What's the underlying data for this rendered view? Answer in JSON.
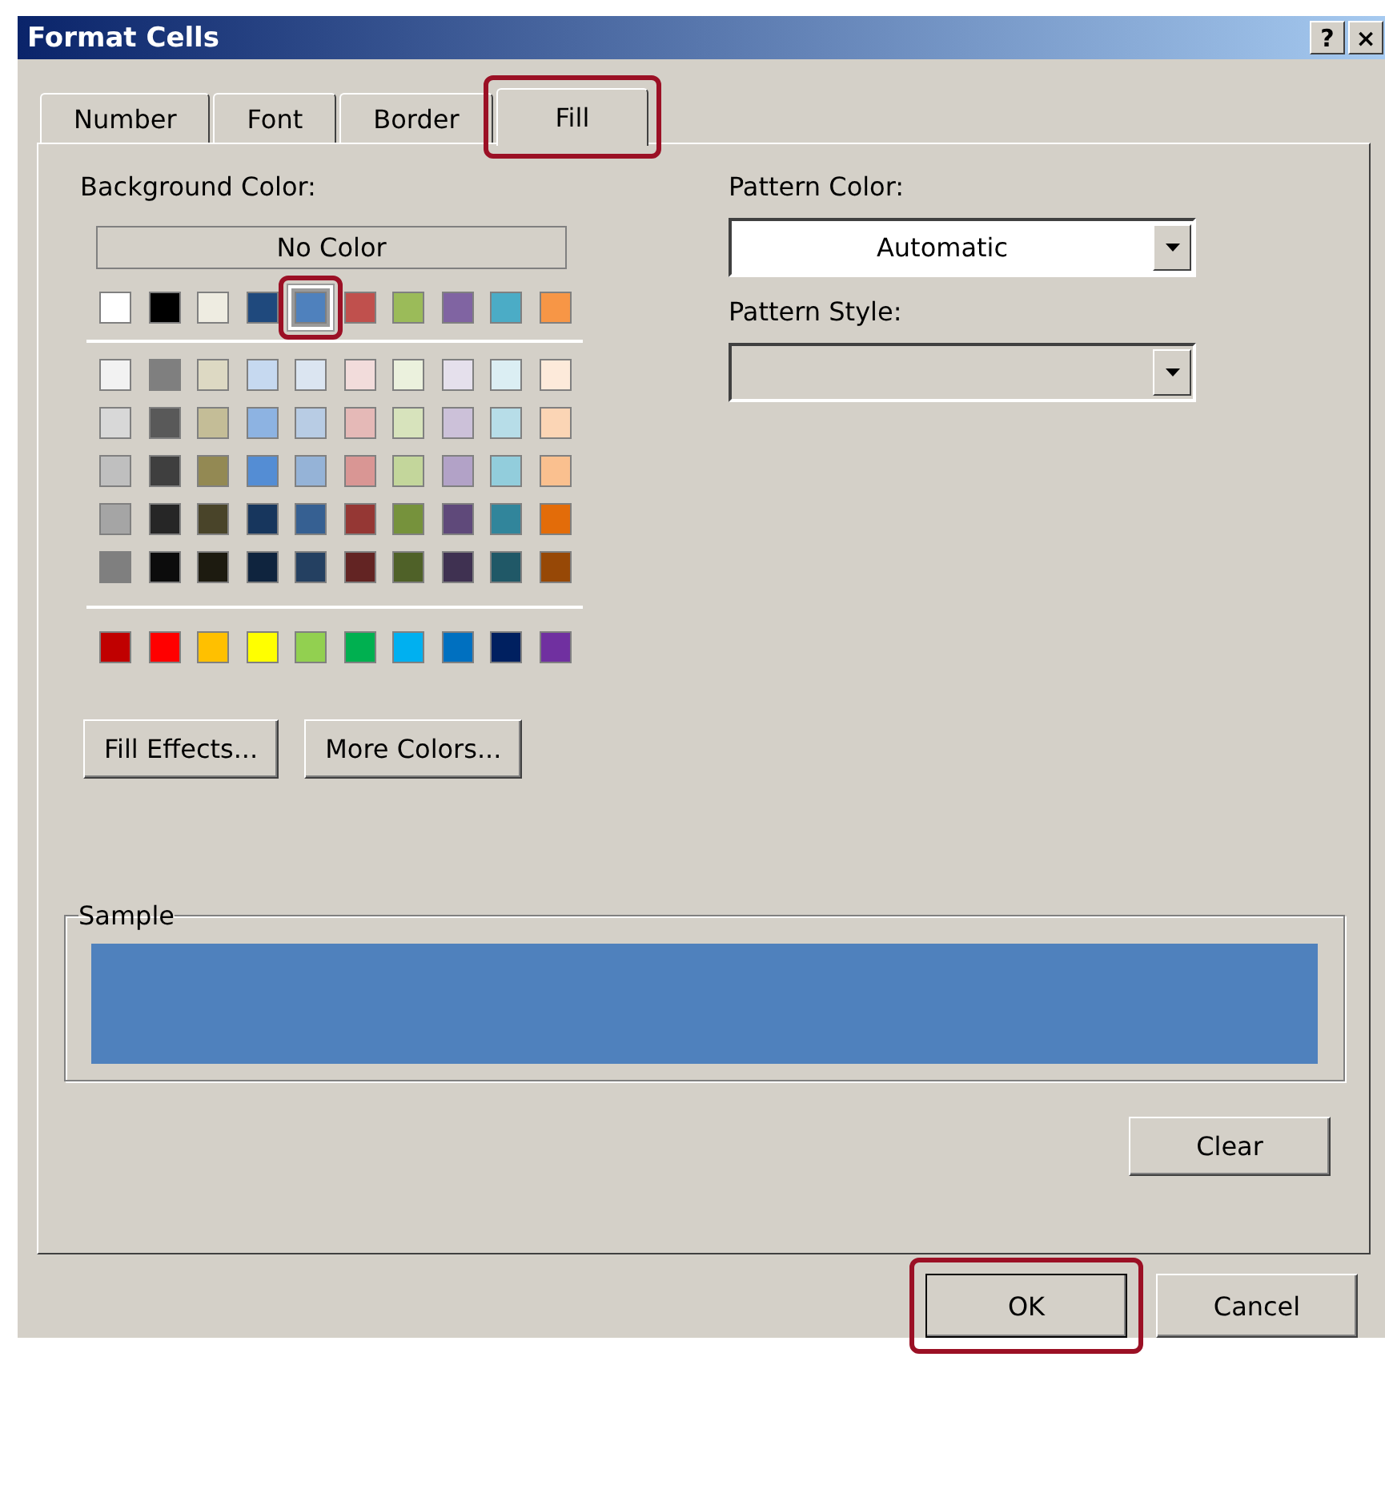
{
  "window": {
    "title": "Format Cells",
    "controls": [
      "?",
      "×"
    ]
  },
  "tabs": [
    {
      "label": "Number",
      "selected": false,
      "highlighted": false
    },
    {
      "label": "Font",
      "selected": false,
      "highlighted": false
    },
    {
      "label": "Border",
      "selected": false,
      "highlighted": false
    },
    {
      "label": "Fill",
      "selected": true,
      "highlighted": true
    }
  ],
  "background_color": {
    "label": "Background Color:",
    "no_color": "No Color",
    "theme_row": [
      {
        "color": "#ffffff",
        "selected": false,
        "highlighted": false
      },
      {
        "color": "#000000",
        "selected": false,
        "highlighted": false
      },
      {
        "color": "#eeece1",
        "selected": false,
        "highlighted": false
      },
      {
        "color": "#1f497d",
        "selected": false,
        "highlighted": false
      },
      {
        "color": "#4f81bd",
        "selected": true,
        "highlighted": true
      },
      {
        "color": "#c0504d",
        "selected": false,
        "highlighted": false
      },
      {
        "color": "#9bbb59",
        "selected": false,
        "highlighted": false
      },
      {
        "color": "#8064a2",
        "selected": false,
        "highlighted": false
      },
      {
        "color": "#4bacc6",
        "selected": false,
        "highlighted": false
      },
      {
        "color": "#f79646",
        "selected": false,
        "highlighted": false
      }
    ],
    "shade_rows": [
      [
        {
          "color": "#f2f2f2"
        },
        {
          "color": "#7f7f7f"
        },
        {
          "color": "#ddd9c3"
        },
        {
          "color": "#c6d9f0"
        },
        {
          "color": "#dbe5f1"
        },
        {
          "color": "#f2dcdb"
        },
        {
          "color": "#ebf1dd"
        },
        {
          "color": "#e5e0ec"
        },
        {
          "color": "#dbeef3"
        },
        {
          "color": "#fdeada"
        }
      ],
      [
        {
          "color": "#d8d8d8"
        },
        {
          "color": "#595959"
        },
        {
          "color": "#c4bd97"
        },
        {
          "color": "#8db3e2"
        },
        {
          "color": "#b8cce4"
        },
        {
          "color": "#e5b9b7"
        },
        {
          "color": "#d7e3bc"
        },
        {
          "color": "#ccc1d9"
        },
        {
          "color": "#b7dde8"
        },
        {
          "color": "#fbd5b5"
        }
      ],
      [
        {
          "color": "#bfbfbf"
        },
        {
          "color": "#3f3f3f"
        },
        {
          "color": "#938953"
        },
        {
          "color": "#548dd4"
        },
        {
          "color": "#95b3d7"
        },
        {
          "color": "#d99694"
        },
        {
          "color": "#c3d69b"
        },
        {
          "color": "#b2a2c7"
        },
        {
          "color": "#92cddc"
        },
        {
          "color": "#fac08f"
        }
      ],
      [
        {
          "color": "#a5a5a5"
        },
        {
          "color": "#262626"
        },
        {
          "color": "#494429"
        },
        {
          "color": "#17365d"
        },
        {
          "color": "#366092"
        },
        {
          "color": "#953734"
        },
        {
          "color": "#76923c"
        },
        {
          "color": "#5f497a"
        },
        {
          "color": "#31859b"
        },
        {
          "color": "#e36c09"
        }
      ],
      [
        {
          "color": "#7f7f7f"
        },
        {
          "color": "#0c0c0c"
        },
        {
          "color": "#1d1b10"
        },
        {
          "color": "#0f243e"
        },
        {
          "color": "#244061"
        },
        {
          "color": "#632423"
        },
        {
          "color": "#4f6128"
        },
        {
          "color": "#3f3151"
        },
        {
          "color": "#205867"
        },
        {
          "color": "#974806"
        }
      ]
    ],
    "standard_row": [
      {
        "color": "#c00000"
      },
      {
        "color": "#ff0000"
      },
      {
        "color": "#ffc000"
      },
      {
        "color": "#ffff00"
      },
      {
        "color": "#92d050"
      },
      {
        "color": "#00b050"
      },
      {
        "color": "#00b0f0"
      },
      {
        "color": "#0070c0"
      },
      {
        "color": "#002060"
      },
      {
        "color": "#7030a0"
      }
    ],
    "buttons": [
      {
        "label": "Fill Effects..."
      },
      {
        "label": "More Colors..."
      }
    ]
  },
  "pattern_color": {
    "label": "Pattern Color:",
    "value": "Automatic"
  },
  "pattern_style": {
    "label": "Pattern Style:"
  },
  "sample": {
    "label": "Sample",
    "color": "#4f81bd"
  },
  "clear_button": {
    "label": "Clear"
  },
  "footer_buttons": [
    {
      "label": "OK",
      "default": true,
      "highlighted": true
    },
    {
      "label": "Cancel",
      "default": false,
      "highlighted": false
    }
  ]
}
